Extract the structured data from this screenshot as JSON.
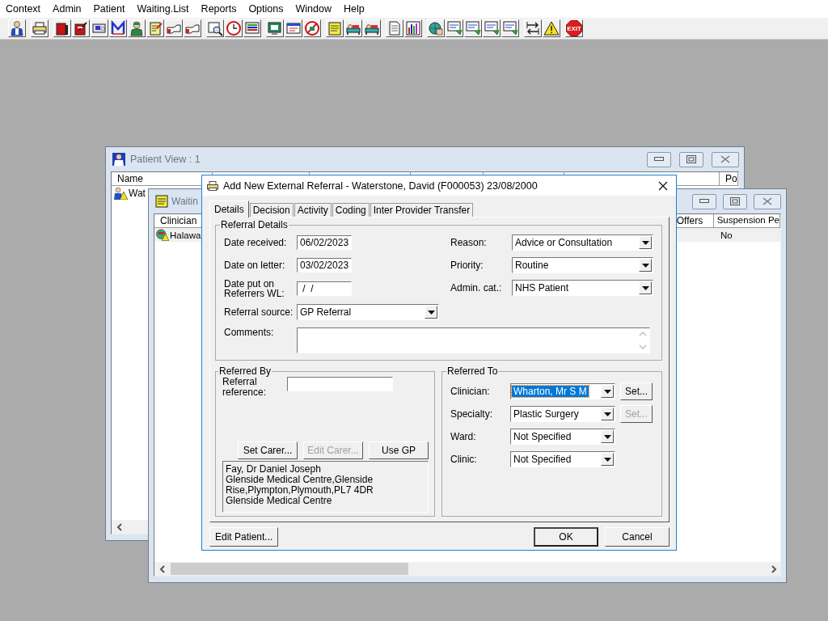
{
  "menu": [
    {
      "label": "Context"
    },
    {
      "label": "Admin"
    },
    {
      "label": "Patient"
    },
    {
      "label": "Waiting.List"
    },
    {
      "label": "Reports"
    },
    {
      "label": "Options"
    },
    {
      "label": "Window"
    },
    {
      "label": "Help"
    }
  ],
  "toolbar": {
    "exit_label": "EXIT"
  },
  "patient_view": {
    "title": "Patient View : 1",
    "active": false,
    "columns": [
      {
        "label": "Name"
      },
      {
        "label": "Po"
      }
    ],
    "rows": [
      {
        "name": "Wat"
      }
    ]
  },
  "waiting_list": {
    "title": "Waitin",
    "active": false,
    "columns": [
      {
        "label": "Clinician"
      },
      {
        "label": "Offers"
      },
      {
        "label": "Suspension Pe"
      }
    ],
    "rows": [
      {
        "clinician": "Halawa",
        "suspension": "No",
        "selected": true
      }
    ]
  },
  "dialog": {
    "title": "Add New External Referral - Waterstone, David (F000053) 23/08/2000",
    "tabs": [
      {
        "label": "Details",
        "selected": true
      },
      {
        "label": "Decision",
        "selected": false
      },
      {
        "label": "Activity",
        "selected": false
      },
      {
        "label": "Coding",
        "selected": false
      },
      {
        "label": "Inter Provider Transfer",
        "selected": false
      }
    ],
    "referral_details": {
      "title": "Referral Details",
      "left_fields": [
        {
          "kind": "date",
          "label": "Date received:",
          "value": "06/02/2023"
        },
        {
          "kind": "date",
          "label": "Date on letter:",
          "value": "03/02/2023"
        },
        {
          "kind": "date",
          "label": "Date put on Referrers WL:",
          "value": " /  /"
        },
        {
          "kind": "combo",
          "label": "Referral source:",
          "value": "GP Referral"
        }
      ],
      "right_fields": [
        {
          "kind": "combo",
          "label": "Reason:",
          "value": "Advice or Consultation"
        },
        {
          "kind": "combo",
          "label": "Priority:",
          "value": "Routine"
        },
        {
          "kind": "combo",
          "label": "Admin. cat.:",
          "value": "NHS Patient"
        }
      ],
      "comments": {
        "label": "Comments:"
      }
    },
    "referred_by": {
      "title": "Referred By",
      "reference_label": "Referral reference:",
      "buttons": [
        {
          "label": "Set Carer...",
          "disabled": false
        },
        {
          "label": "Edit Carer...",
          "disabled": true
        },
        {
          "label": "Use GP",
          "disabled": false
        }
      ],
      "address_lines": [
        "Fay, Dr Daniel Joseph",
        "Glenside Medical Centre,Glenside",
        "Rise,Plympton,Plymouth,PL7 4DR",
        "Glenside Medical Centre"
      ]
    },
    "referred_to": {
      "title": "Referred To",
      "fields": [
        {
          "label": "Clinician:",
          "value": "Wharton, Mr S M",
          "focused": true,
          "set_button": {
            "label": "Set...",
            "disabled": false
          }
        },
        {
          "label": "Specialty:",
          "value": "Plastic Surgery",
          "focused": false,
          "set_button": {
            "label": "Set...",
            "disabled": true
          }
        },
        {
          "label": "Ward:",
          "value": "Not Specified",
          "focused": false
        },
        {
          "label": "Clinic:",
          "value": "Not Specified",
          "focused": false
        }
      ]
    },
    "footer_buttons": [
      {
        "kind": "left",
        "label": "Edit Patient..."
      },
      {
        "kind": "default",
        "label": "OK"
      },
      {
        "kind": "normal",
        "label": "Cancel"
      }
    ]
  }
}
